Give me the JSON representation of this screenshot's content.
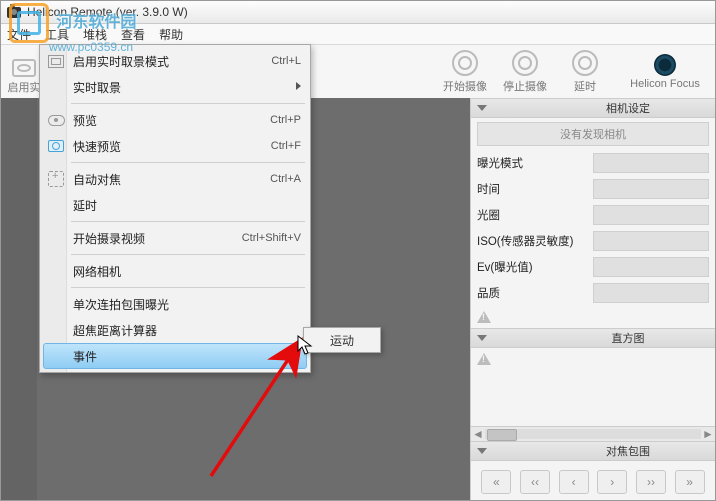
{
  "window": {
    "title": "Helicon Remote (ver. 3.9.0 W)"
  },
  "menubar": {
    "items": [
      "文件",
      "工具",
      "堆栈",
      "查看",
      "帮助"
    ]
  },
  "watermark": {
    "name": "河东软件园",
    "url": "www.pc0359.cn"
  },
  "toolbar": {
    "left_stub": "启用实",
    "buttons": [
      {
        "label": "开始摄像"
      },
      {
        "label": "停止摄像"
      },
      {
        "label": "延时"
      },
      {
        "label": "Helicon Focus"
      }
    ]
  },
  "dropdown": {
    "items": [
      {
        "label": "启用实时取景模式",
        "shortcut": "Ctrl+L"
      },
      {
        "label": "实时取景",
        "submenu": true
      },
      {
        "label": "预览",
        "shortcut": "Ctrl+P"
      },
      {
        "label": "快速预览",
        "shortcut": "Ctrl+F"
      },
      {
        "label": "自动对焦",
        "shortcut": "Ctrl+A"
      },
      {
        "label": "延时"
      },
      {
        "label": "开始摄录视频",
        "shortcut": "Ctrl+Shift+V"
      },
      {
        "label": "网络相机"
      },
      {
        "label": "单次连拍包围曝光"
      },
      {
        "label": "超焦距离计算器"
      },
      {
        "label": "事件",
        "submenu": true,
        "highlight": true
      }
    ],
    "submenu_label": "运动"
  },
  "rightpanel": {
    "camera_settings": {
      "header": "相机设定",
      "no_camera": "没有发现相机",
      "rows": [
        "曝光模式",
        "时间",
        "光圈",
        "ISO(传感器灵敏度)",
        "Ev(曝光值)",
        "品质"
      ]
    },
    "histogram": {
      "header": "直方图"
    },
    "focus_bracket": {
      "header": "对焦包围",
      "buttons": [
        "«",
        "‹‹",
        "‹",
        "›",
        "››",
        "»"
      ]
    }
  }
}
